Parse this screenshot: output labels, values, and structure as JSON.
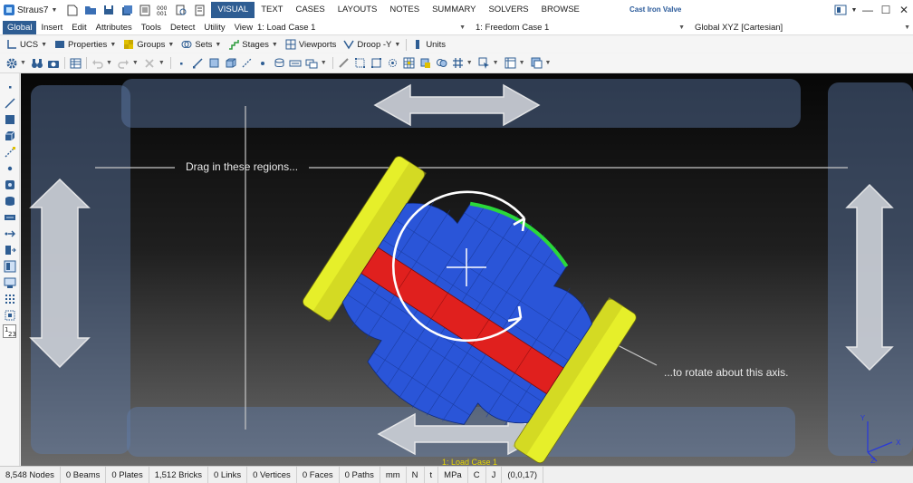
{
  "app": {
    "name": "Straus7",
    "document_title": "Cast Iron Valve"
  },
  "ribbon_tabs": [
    "VISUAL",
    "TEXT",
    "CASES",
    "LAYOUTS",
    "NOTES",
    "SUMMARY",
    "SOLVERS",
    "BROWSE"
  ],
  "ribbon_active": "VISUAL",
  "context": {
    "tabs": [
      "Global",
      "Insert",
      "Edit",
      "Attributes",
      "Tools",
      "Detect",
      "Utility",
      "View"
    ],
    "active_tab": "Global",
    "load_case": "1: Load Case 1",
    "freedom_case": "1: Freedom Case 1",
    "coord_system": "Global XYZ [Cartesian]"
  },
  "menubar": {
    "ucs": "UCS",
    "properties": "Properties",
    "groups": "Groups",
    "sets": "Sets",
    "stages": "Stages",
    "viewports": "Viewports",
    "droop": "Droop -Y",
    "units": "Units"
  },
  "viewport": {
    "drag_hint": "Drag in these regions...",
    "axis_hint": "...to rotate about this axis.",
    "load_case_label": "1: Load Case 1",
    "triad": {
      "x": "X",
      "y": "Y",
      "z": "Z"
    }
  },
  "statusbar": {
    "nodes": "8,548 Nodes",
    "beams": "0 Beams",
    "plates": "0 Plates",
    "bricks": "1,512 Bricks",
    "links": "0 Links",
    "vertices": "0 Vertices",
    "faces": "0 Faces",
    "paths": "0 Paths",
    "length_unit": "mm",
    "force_unit": "N",
    "mass_unit": "t",
    "stress_unit": "MPa",
    "temp_unit": "C",
    "energy_unit": "J",
    "cursor": "(0,0,17)"
  },
  "colors": {
    "accent": "#2e5d93",
    "model_body": "#2a55d8",
    "model_flange": "#e6ef2a",
    "model_band": "#e0201e",
    "model_top_edge": "#2ad83a",
    "zone": "#5f7daa"
  }
}
